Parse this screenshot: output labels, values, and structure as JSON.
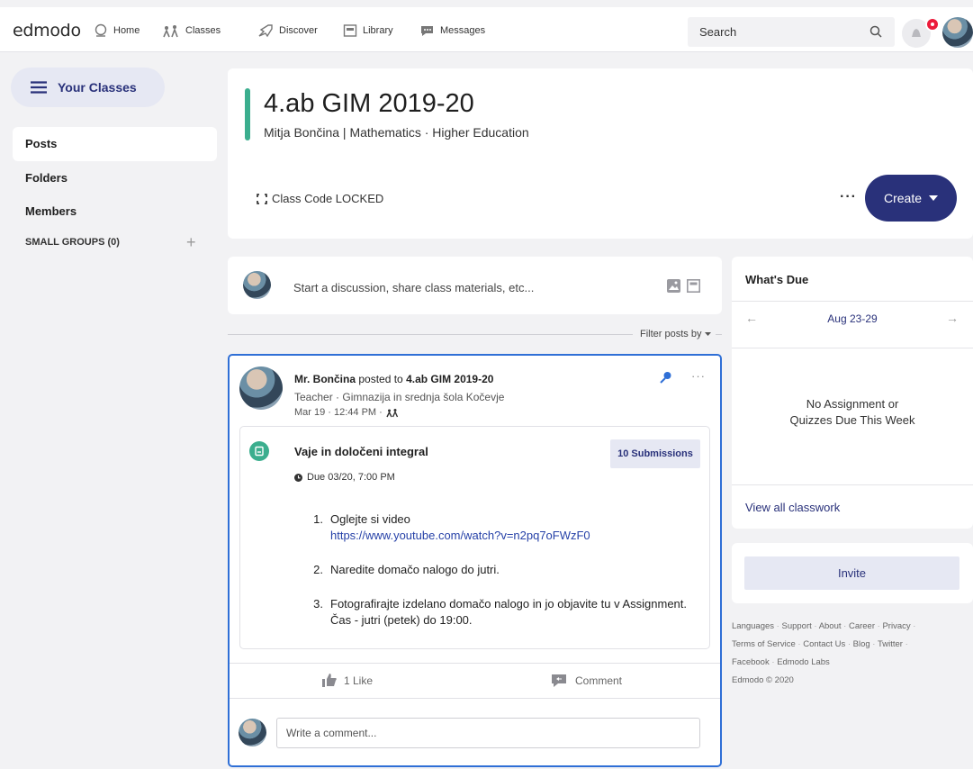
{
  "topbar": {
    "logo": "edmodo",
    "nav": [
      {
        "label": "Home",
        "icon": "home-icon"
      },
      {
        "label": "Classes",
        "icon": "classes-icon"
      },
      {
        "label": "Discover",
        "icon": "discover-icon"
      },
      {
        "label": "Library",
        "icon": "library-icon"
      },
      {
        "label": "Messages",
        "icon": "messages-icon"
      }
    ],
    "search_placeholder": "Search"
  },
  "sidebar": {
    "your_classes": "Your Classes",
    "items": [
      {
        "label": "Posts",
        "active": true
      },
      {
        "label": "Folders",
        "active": false
      },
      {
        "label": "Members",
        "active": false
      }
    ],
    "small_groups": "SMALL GROUPS (0)",
    "add_symbol": "+"
  },
  "class": {
    "title": "4.ab GIM 2019-20",
    "subtitle": "Mitja Bončina | Mathematics  · Higher Education",
    "code_label": "Class Code LOCKED",
    "more": "···",
    "create_label": "Create",
    "accent_color": "#3bae8e"
  },
  "composer": {
    "placeholder": "Start a discussion, share class materials, etc..."
  },
  "filter": {
    "label": "Filter posts by"
  },
  "post": {
    "author": "Mr. Bončina",
    "posted_to_word": " posted to ",
    "target": "4.ab GIM 2019-20",
    "role": "Teacher · Gimnazija in srednja šola Kočevje",
    "time": "Mar 19 · 12:44 PM ·",
    "more": "···",
    "assignment": {
      "title": "Vaje in določeni integral",
      "submissions": "10 Submissions",
      "due": "Due 03/20, 7:00 PM",
      "steps": [
        {
          "num": "1.",
          "text": "Oglejte si video",
          "link": "https://www.youtube.com/watch?v=n2pq7oFWzF0"
        },
        {
          "num": "2.",
          "text": "Naredite domačo nalogo do jutri."
        },
        {
          "num": "3.",
          "text": "Fotografirajte izdelano domačo nalogo in jo objavite tu v Assignment. Čas - jutri (petek) do 19:00."
        }
      ]
    },
    "like_label": "1 Like",
    "comment_label": "Comment",
    "comment_placeholder": "Write a comment..."
  },
  "whats_due": {
    "heading": "What's Due",
    "prev": "←",
    "range": "Aug 23-29",
    "next": "→",
    "empty_line1": "No Assignment or",
    "empty_line2": "Quizzes Due This Week",
    "view_all": "View all classwork"
  },
  "invite": {
    "label": "Invite"
  },
  "footer": {
    "links": [
      "Languages",
      "Support",
      "About",
      "Career",
      "Privacy",
      "Terms of Service",
      "Contact Us",
      "Blog",
      "Twitter",
      "Facebook",
      "Edmodo Labs"
    ],
    "copyright": "Edmodo © 2020"
  }
}
